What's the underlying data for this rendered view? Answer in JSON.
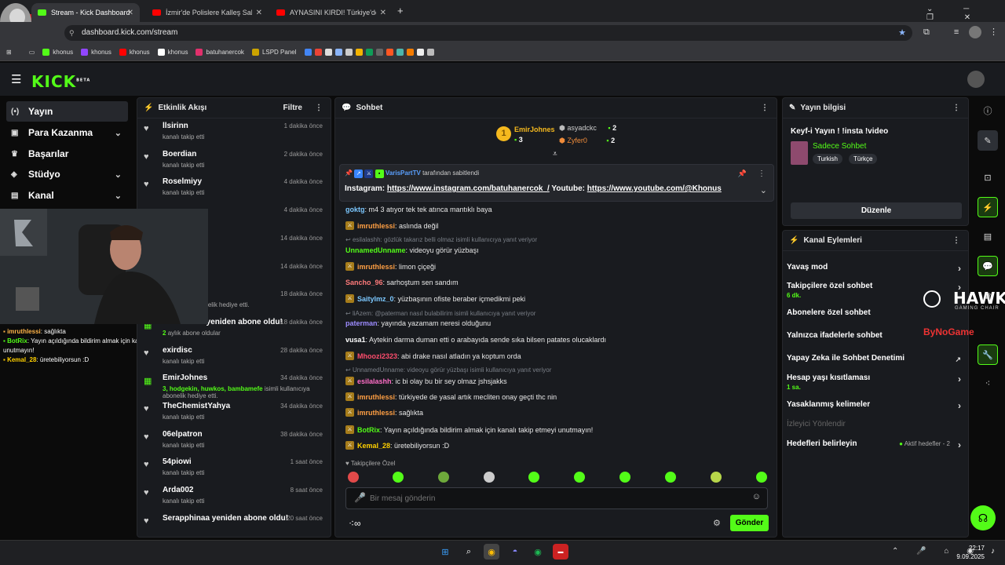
{
  "browser": {
    "tabs": [
      {
        "title": "Stream - Kick Dashboard"
      },
      {
        "title": "İzmir'de Polislere Kalleş Saldırı!"
      },
      {
        "title": "AYNASINI KIRDI! Türkiye'de Ya"
      }
    ],
    "url": "dashboard.kick.com/stream",
    "bookmarks": [
      "khonus",
      "khonus",
      "khonus",
      "khonus",
      "batuhanercok",
      "LSPD Panel"
    ]
  },
  "header": {
    "logo": "KICK",
    "logo_sup": "BETA"
  },
  "sidebar": {
    "items": [
      {
        "label": "Yayın",
        "icon": "broadcast-icon"
      },
      {
        "label": "Para Kazanma",
        "icon": "money-icon"
      },
      {
        "label": "Başarılar",
        "icon": "trophy-icon"
      },
      {
        "label": "Stüdyo",
        "icon": "studio-icon"
      },
      {
        "label": "Kanal",
        "icon": "channel-icon"
      }
    ]
  },
  "overlay": {
    "chat": [
      {
        "user": "imruthlessi",
        "text": ": sağlıkta"
      },
      {
        "user": "BotRix",
        "text": ": Yayın açıldığında bildirim almak için kanalı takip etmeyi unutmayın!"
      },
      {
        "user": "Kemal_28",
        "text": ": üretebiliyorsun :D"
      }
    ]
  },
  "activity": {
    "title": "Etkinlik Akışı",
    "filter": "Filtre",
    "items": [
      {
        "name": "llsirinn",
        "desc": "kanalı takip etti",
        "time": "1 dakika önce"
      },
      {
        "name": "Boerdian",
        "desc": "kanalı takip etti",
        "time": "2 dakika önce"
      },
      {
        "name": "Roselmiyy",
        "desc": "kanalı takip etti",
        "time": "4 dakika önce"
      },
      {
        "name": "",
        "desc": "",
        "time": "4 dakika önce"
      },
      {
        "name": "",
        "desc": "",
        "time": "14 dakika önce"
      },
      {
        "name": "",
        "desc": "",
        "time": "14 dakika önce"
      },
      {
        "name": "",
        "desc": "kullanıcıya abonelik hediye etti.",
        "time": "18 dakika önce"
      },
      {
        "name": "AtakaNN99 yeniden abone oldu!",
        "desc_green": "2",
        "desc": "aylık abone oldular",
        "time": "18 dakika önce"
      },
      {
        "name": "exirdisc",
        "desc": "kanalı takip etti",
        "time": "28 dakika önce"
      },
      {
        "name": "EmirJohnes",
        "desc_green": "3, hodgekin, huwkos, bambamefe",
        "desc": "isimli kullanıcıya",
        "desc2": "abonelik hediye etti.",
        "time": "34 dakika önce"
      },
      {
        "name": "TheChemistYahya",
        "desc": "kanalı takip etti",
        "time": "34 dakika önce"
      },
      {
        "name": "06elpatron",
        "desc": "kanalı takip etti",
        "time": "38 dakika önce"
      },
      {
        "name": "54piowi",
        "desc": "kanalı takip etti",
        "time": "1 saat önce"
      },
      {
        "name": "Arda002",
        "desc": "kanalı takip etti",
        "time": "8 saat önce"
      },
      {
        "name": "Serapphinaa yeniden abone oldu!",
        "desc": "",
        "time": "20 saat önce"
      }
    ]
  },
  "chat": {
    "title": "Sohbet",
    "leaderboard": {
      "first": {
        "rank": "1",
        "name": "EmirJohnes",
        "count": "3"
      },
      "second": {
        "name": "asyadckc",
        "count": "2"
      },
      "third": {
        "name": "Zyfer0",
        "count": "2"
      }
    },
    "pinned": {
      "by_user": "VarisPartTV",
      "by_text": "tarafından sabitlendi",
      "label_insta": "Instagram:",
      "link_insta": "https://www.instagram.com/batuhanercok_/",
      "label_yt": "Youtube:",
      "link_yt": "https://www.youtube.com/@Khonus"
    },
    "messages": [
      {
        "user": "goktg",
        "color": "#7cc8ff",
        "text": ": m4 3 atıyor tek tek atınca mantıklı baya",
        "badge": false
      },
      {
        "user": "imruthlessi",
        "color": "#ff9f43",
        "text": ": aslında değil",
        "badge": true
      },
      {
        "reply": "esilalashh: gözlük takarız belli olmaz isimli kullanıcıya yanıt veriyor"
      },
      {
        "user": "UnnamedUnname",
        "color": "#53fc18",
        "text": ": videoyu görür yüzbaşı",
        "badge": false
      },
      {
        "user": "imruthlessi",
        "color": "#ff9f43",
        "text": ": limon çiçeği",
        "badge": true
      },
      {
        "user": "Sancho_96",
        "color": "#ff7a7a",
        "text": ": sarhoştum sen sandım",
        "badge": false
      },
      {
        "user": "Saitylmz_0",
        "color": "#7cc8ff",
        "text": ": yüzbaşının ofiste beraber içmedikmi peki",
        "badge": true
      },
      {
        "reply": "liAzem: @paterman nasıl bulabilirim isimli kullanıcıya yanıt veriyor"
      },
      {
        "user": "paterman",
        "color": "#9d8cff",
        "text": ": yayında yazamam neresi olduğunu",
        "badge": false
      },
      {
        "user": "vusa1",
        "color": "#ffffff",
        "text": ": Aytekin darma duman etti o arabayıda sende sıka bilsen patates olucaklardı",
        "badge": false
      },
      {
        "user": "Mhoozi2323",
        "color": "#ff4d6d",
        "text": ": abi drake nasıl atladın ya koptum orda",
        "badge": true
      },
      {
        "reply": "UnnamedUnname: videoyu görür yüzbaşı isimli kullanıcıya yanıt veriyor"
      },
      {
        "user": "esilalashh",
        "color": "#ff6ec7",
        "text": ": ic bi olay bu bir sey olmaz jshsjakks",
        "badge": true
      },
      {
        "user": "imruthlessi",
        "color": "#ff9f43",
        "text": ": türkiyede de yasal artık mecliten onay geçti thc nin",
        "badge": true
      },
      {
        "user": "imruthlessi",
        "color": "#ff9f43",
        "text": ": sağlıkta",
        "badge": true
      },
      {
        "user": "BotRix",
        "color": "#53fc18",
        "text": ": Yayın açıldığında bildirim almak için kanalı takip etmeyi unutmayın!",
        "badge": true
      },
      {
        "user": "Kemal_28",
        "color": "#ffd000",
        "text": ": üretebiliyorsun :D",
        "badge": true
      }
    ],
    "followers_only": "Takipçilere Özel",
    "input_placeholder": "Bir mesaj gönderin",
    "send_label": "Gönder"
  },
  "stream_info": {
    "title": "Yayın bilgisi",
    "stream_title": "Keyf-i Yayın ! !insta !video",
    "category": "Sadece Sohbet",
    "tags": [
      "Turkish",
      "Türkçe"
    ],
    "edit_label": "Düzenle"
  },
  "channel_actions": {
    "title": "Kanal Eylemleri",
    "items": [
      {
        "label": "Yavaş mod",
        "sub": ""
      },
      {
        "label": "Takipçilere özel sohbet",
        "sub": "6 dk."
      },
      {
        "label": "Abonelere özel sohbet",
        "sub": ""
      },
      {
        "label": "Yalnızca ifadelerle sohbet",
        "sub": ""
      },
      {
        "label": "Yapay Zeka ile Sohbet Denetimi",
        "sub": ""
      },
      {
        "label": "Hesap yaşı kısıtlaması",
        "sub": "1 sa."
      },
      {
        "label": "Yasaklanmış kelimeler",
        "sub": ""
      },
      {
        "label": "İzleyici Yönlendir",
        "sub": ""
      },
      {
        "label": "Hedefleri belirleyin",
        "sub": ""
      }
    ],
    "goals_status": "Aktif hedefler - 2"
  },
  "watermark": {
    "brand": "HAWK",
    "sub": "GAMING CHAIR",
    "partner": "ByNoGame"
  },
  "taskbar": {
    "time": "22:17",
    "date": "9.09.2025"
  },
  "colors": {
    "accent": "#53fc18",
    "panel": "#191b1f",
    "bg": "#0b0b0b"
  }
}
